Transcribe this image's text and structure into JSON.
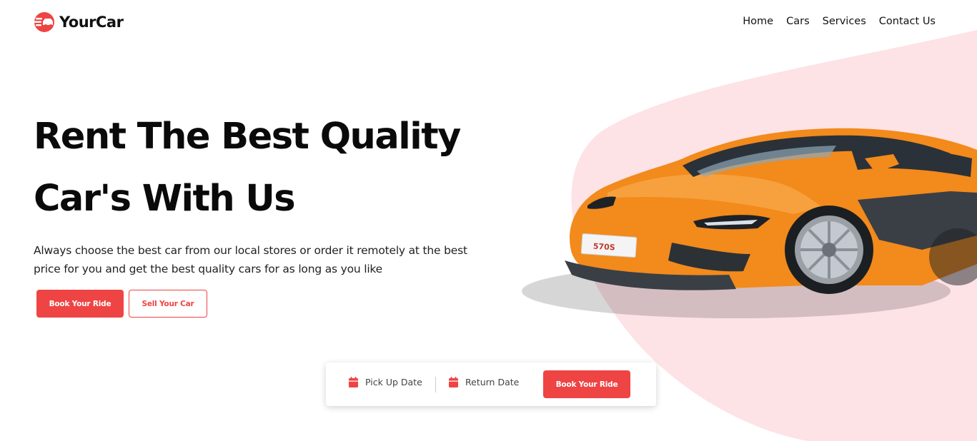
{
  "brand": {
    "name": "YourCar",
    "accent_color": "#ee4444",
    "blob_color": "#fde2e6"
  },
  "nav": {
    "items": [
      {
        "label": "Home"
      },
      {
        "label": "Cars"
      },
      {
        "label": "Services"
      },
      {
        "label": "Contact Us"
      }
    ]
  },
  "hero": {
    "title_line1": "Rent The Best Quality",
    "title_line2": "Car's With Us",
    "description": "Always choose the best car from our local stores or order it remotely at the best price for you and get the best quality cars for as long as you like",
    "primary_button": "Book Your Ride",
    "secondary_button": "Sell Your Car",
    "car_plate": "570S",
    "car_color": "#f28a1c"
  },
  "booking": {
    "pickup_label": "Pick Up Date",
    "return_label": "Return Date",
    "button_label": "Book Your Ride",
    "icon": "calendar-icon"
  }
}
